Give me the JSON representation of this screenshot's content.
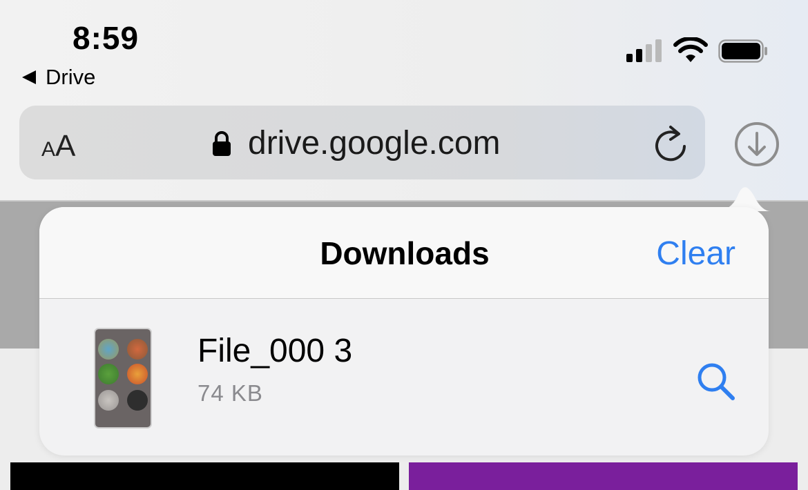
{
  "status_bar": {
    "time": "8:59",
    "back_app_label": "Drive",
    "signal_bars_active": 2,
    "signal_bars_total": 4,
    "battery_level": 1.0
  },
  "url_bar": {
    "text_size_label_small": "A",
    "text_size_label_big": "A",
    "domain": "drive.google.com",
    "lock_icon": "lock-icon",
    "reload_icon": "reload-icon",
    "downloads_icon": "download-circle-icon"
  },
  "downloads": {
    "title": "Downloads",
    "clear_label": "Clear",
    "items": [
      {
        "name": "File_000 3",
        "size": "74 KB",
        "action_icon": "magnifier-icon"
      }
    ]
  },
  "colors": {
    "accent": "#2f7ff0",
    "tile_left": "#000000",
    "tile_right": "#7a1f9c"
  }
}
